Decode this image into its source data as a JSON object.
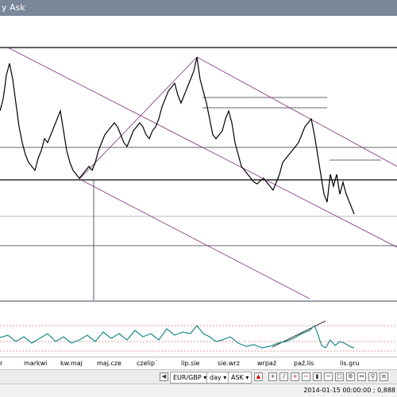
{
  "window": {
    "title": "y Ask"
  },
  "x_axis": {
    "ticks": [
      "r",
      "markwi",
      "kw.maj",
      "maj.cze",
      "czelip´",
      "lip.sie",
      "sie.wrz",
      "wrpaź",
      "paź.lis",
      "lis.gru"
    ]
  },
  "toolbar": {
    "symbol": "EUR/GBP",
    "period": "day",
    "price_side": "ASK",
    "icons": [
      "cursor-icon",
      "crosshair-icon",
      "line-icon",
      "zoom-in-icon",
      "zoom-out-icon",
      "chart-type-icon",
      "indicator-icon"
    ]
  },
  "status": {
    "text": "2014-01-15 00:00:00 ; 0,888"
  },
  "colors": {
    "titlebar": "#7b8699",
    "trendline": "#7e2d7e",
    "oscillator": "#1b8a8a",
    "level": "#cc3333"
  }
}
